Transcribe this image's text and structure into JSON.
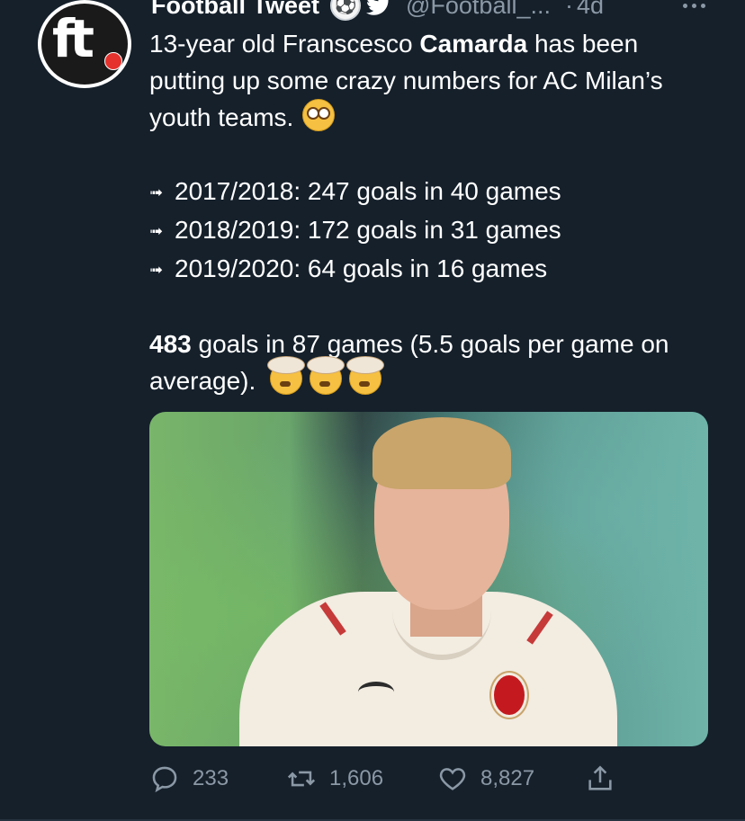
{
  "author": {
    "display_name": "Football Tweet",
    "handle": "@Football_...",
    "separator": "·",
    "time": "4d",
    "avatar_icon": "ft-logo-icon",
    "badge_icons": [
      "soccer-ball-icon",
      "twitter-bird-icon"
    ]
  },
  "tweet": {
    "intro_before": "13-year old Franscesco ",
    "intro_bold": "Camarda",
    "intro_after": " has been putting up some crazy numbers for AC Milan’s youth teams.",
    "intro_emoji": "flushed-face-emoji",
    "stats": [
      {
        "arrow": "➟",
        "text": "2017/2018: 247 goals in 40 games"
      },
      {
        "arrow": "➟",
        "text": "2018/2019: 172 goals in 31 games"
      },
      {
        "arrow": "➟",
        "text": "2019/2020: 64 goals in 16 games"
      }
    ],
    "summary_bold": "483",
    "summary_text": " goals in 87 games (5.5 goals per game on average).",
    "summary_emojis": [
      "exploding-head-emoji",
      "exploding-head-emoji",
      "exploding-head-emoji"
    ]
  },
  "media": {
    "description_icon": "photo-of-young-player-in-milan-kit"
  },
  "actions": {
    "reply_count": "233",
    "retweet_count": "1,606",
    "like_count": "8,827"
  },
  "colors": {
    "background": "#15202b",
    "primary_text": "#ffffff",
    "secondary_text": "#8b98a5",
    "bird_blue": "#ffffff"
  }
}
